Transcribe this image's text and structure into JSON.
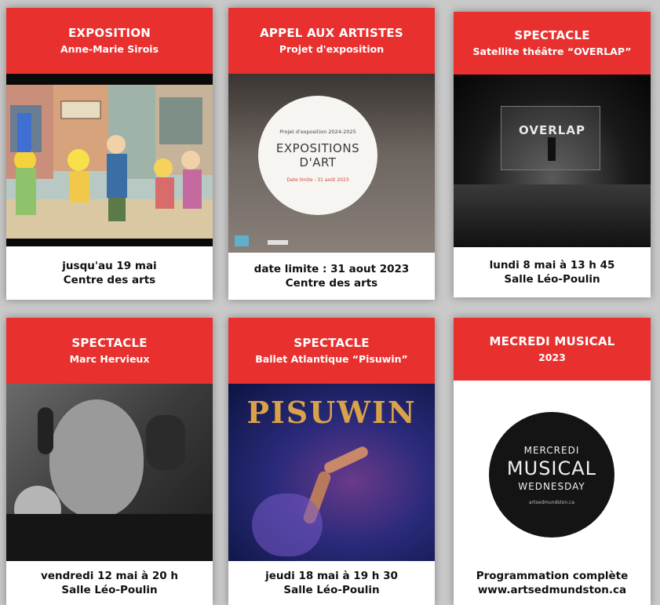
{
  "cards": [
    {
      "title": "EXPOSITION",
      "subtitle": "Anne-Marie Sirois",
      "footer_line1": "jusqu'au 19 mai",
      "footer_line2": "Centre des arts"
    },
    {
      "title": "APPEL AUX ARTISTES",
      "subtitle": "Projet d'exposition",
      "image_small": "Projet d'exposition 2024-2025",
      "image_title1": "EXPOSITIONS",
      "image_title2": "D'ART",
      "image_date": "Date limite : 31 août 2023",
      "footer_line1": "date limite : 31 aout 2023",
      "footer_line2": "Centre des arts"
    },
    {
      "title": "SPECTACLE",
      "subtitle": "Satellite théâtre “OVERLAP”",
      "image_text": "OVERLAP",
      "footer_line1": "lundi 8 mai à 13 h 45",
      "footer_line2": "Salle Léo-Poulin"
    },
    {
      "title": "SPECTACLE",
      "subtitle": "Marc Hervieux",
      "footer_line1": "vendredi 12 mai à 20 h",
      "footer_line2": "Salle Léo-Poulin"
    },
    {
      "title": "SPECTACLE",
      "subtitle": "Ballet Atlantique “Pisuwin”",
      "image_text": "PISUWIN",
      "footer_line1": "jeudi 18 mai à 19 h 30",
      "footer_line2": "Salle Léo-Poulin"
    },
    {
      "title": "MECREDI MUSICAL",
      "subtitle": "2023",
      "logo_line1": "MERCREDI",
      "logo_line2": "MUSICAL",
      "logo_line3": "WEDNESDAY",
      "logo_line4": "artsedmundston.ca",
      "footer_line1": "Programmation complète",
      "footer_line2": "www.artsedmundston.ca"
    }
  ],
  "colors": {
    "header_red": "#e8312f",
    "page_bg": "#c9c9c9",
    "card_bg": "#ffffff"
  }
}
